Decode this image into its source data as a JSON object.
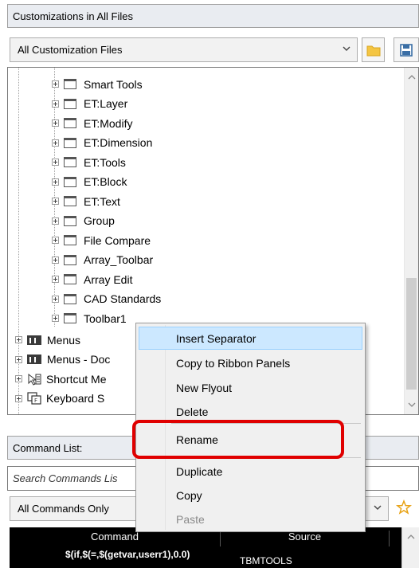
{
  "customizations": {
    "header": "Customizations in All Files",
    "files_combo": "All Customization Files"
  },
  "tree": {
    "toolbar_items": [
      "Smart Tools",
      "ET:Layer",
      "ET:Modify",
      "ET:Dimension",
      "ET:Tools",
      "ET:Block",
      "ET:Text",
      "Group",
      "File Compare",
      "Array_Toolbar",
      "Array Edit",
      "CAD Standards",
      "Toolbar1"
    ],
    "root_items": [
      {
        "label": "Menus",
        "icon": "menu-icon"
      },
      {
        "label": "Menus - Doc",
        "icon": "menu-icon"
      },
      {
        "label": "Shortcut Me",
        "icon": "shortcut-menu-icon"
      },
      {
        "label": "Keyboard S",
        "icon": "keyboard-shortcut-icon"
      }
    ]
  },
  "context_menu": {
    "items": [
      {
        "label": "Insert Separator",
        "state": "highlighted"
      },
      {
        "label": "Copy to Ribbon Panels",
        "state": "normal"
      },
      {
        "label": "New Flyout",
        "state": "normal"
      },
      {
        "label": "Delete",
        "state": "normal"
      },
      {
        "label": "Rename",
        "state": "normal"
      },
      {
        "label": "Duplicate",
        "state": "normal"
      },
      {
        "label": "Copy",
        "state": "normal"
      },
      {
        "label": "Paste",
        "state": "disabled"
      }
    ]
  },
  "command_list": {
    "header": "Command List:",
    "search_placeholder": "Search Commands Lis",
    "filter_combo": "All Commands Only",
    "columns": [
      "Command",
      "Source"
    ],
    "rows": [
      {
        "command": "$(if,$(=,$(getvar,userr1),0.0)",
        "source": "TBMTOOLS"
      }
    ]
  },
  "colors": {
    "highlight_bg": "#cce8ff",
    "annotation_red": "#e00000",
    "folder_yellow": "#f4c542",
    "save_blue": "#3a6ea5",
    "star_gold": "#e8a317"
  }
}
